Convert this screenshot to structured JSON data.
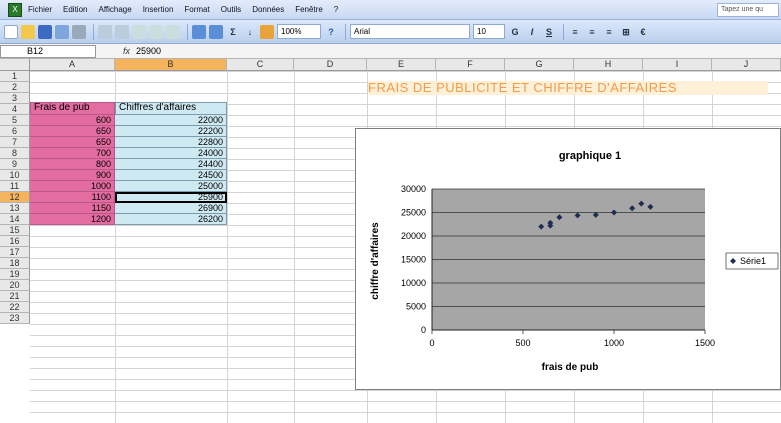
{
  "menubar": {
    "items": [
      "Fichier",
      "Edition",
      "Affichage",
      "Insertion",
      "Format",
      "Outils",
      "Données",
      "Fenêtre",
      "?"
    ],
    "help_placeholder": "Tapez une qu"
  },
  "toolbar": {
    "font": "Arial",
    "font_size": "10",
    "zoom": "100%",
    "bold": "G",
    "italic": "I",
    "underline": "S"
  },
  "formula_bar": {
    "cell_ref": "B12",
    "fx": "fx",
    "value": "25900"
  },
  "columns": [
    "A",
    "B",
    "C",
    "D",
    "E",
    "F",
    "G",
    "H",
    "I",
    "J"
  ],
  "rows": [
    "1",
    "2",
    "3",
    "4",
    "5",
    "6",
    "7",
    "8",
    "9",
    "10",
    "11",
    "12",
    "13",
    "14",
    "15",
    "16",
    "17",
    "18",
    "19",
    "20",
    "21",
    "22",
    "23"
  ],
  "sheet": {
    "title": "FRAIS DE PUBLICITE ET CHIFFRE D'AFFAIRES",
    "header_a": "Frais de pub",
    "header_b": "Chiffres d'affaires",
    "frais": [
      "600",
      "650",
      "650",
      "700",
      "800",
      "900",
      "1000",
      "1100",
      "1150",
      "1200"
    ],
    "chiffres": [
      "22000",
      "22200",
      "22800",
      "24000",
      "24400",
      "24500",
      "25000",
      "25900",
      "26900",
      "26200"
    ]
  },
  "chart_data": {
    "type": "scatter",
    "title": "graphique 1",
    "xlabel": "frais de pub",
    "ylabel": "chiffre d'affaires",
    "xlim": [
      0,
      1500
    ],
    "ylim": [
      0,
      30000
    ],
    "xticks": [
      "0",
      "500",
      "1000",
      "1500"
    ],
    "yticks": [
      "0",
      "5000",
      "10000",
      "15000",
      "20000",
      "25000",
      "30000"
    ],
    "legend_position": "right",
    "plot_background": "#a6a6a6",
    "grid": true,
    "series": [
      {
        "name": "Série1",
        "x": [
          600,
          650,
          650,
          700,
          800,
          900,
          1000,
          1100,
          1150,
          1200
        ],
        "y": [
          22000,
          22200,
          22800,
          24000,
          24400,
          24500,
          25000,
          25900,
          26900,
          26200
        ]
      }
    ]
  }
}
